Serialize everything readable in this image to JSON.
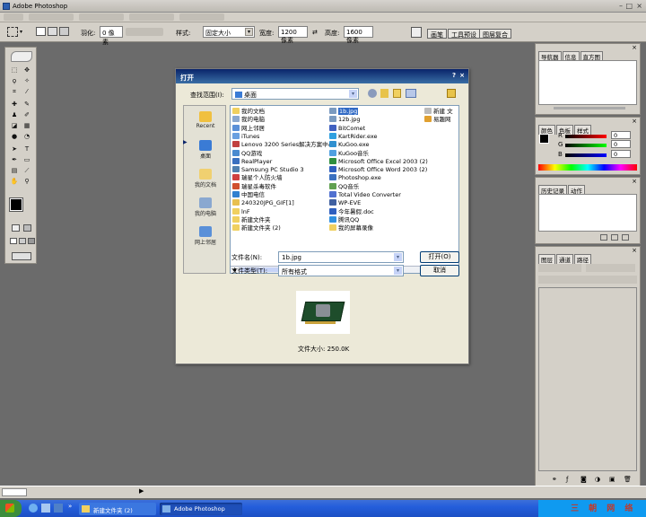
{
  "window": {
    "title": "Adobe Photoshop"
  },
  "options_bar": {
    "feather_label": "羽化:",
    "feather_value": "0 像素",
    "style_label": "样式:",
    "style_value": "固定大小",
    "width_label": "宽度:",
    "width_value": "1200 像素",
    "height_label": "高度:",
    "height_value": "1600 像素",
    "palette_tabs": [
      "画笔",
      "工具预设",
      "图层复合"
    ]
  },
  "panels": {
    "navigator_tabs": [
      "导航器",
      "信息",
      "直方图"
    ],
    "color_tabs": [
      "颜色",
      "色板",
      "样式"
    ],
    "color_values": [
      {
        "channel": "R",
        "value": "0"
      },
      {
        "channel": "G",
        "value": "0"
      },
      {
        "channel": "B",
        "value": "0"
      }
    ],
    "history_tabs": [
      "历史记录",
      "动作"
    ],
    "layers_tabs": [
      "图层",
      "通道",
      "路径"
    ]
  },
  "dialog": {
    "title": "打开",
    "help": "?",
    "close": "×",
    "look_in_label": "查找范围(I):",
    "look_in_value": "桌面",
    "places": [
      "Recent",
      "桌面",
      "我的文档",
      "我的电脑",
      "网上邻居"
    ],
    "files_col1": [
      "我的文档",
      "我的电脑",
      "网上邻居",
      "iTunes",
      "Lenovo 3200 Series解决方案中心",
      "QQ游戏",
      "RealPlayer",
      "Samsung PC Studio 3",
      "瑞星个人防火墙",
      "瑞星杀毒软件",
      "中国电信",
      "240320JPG_GIF[1]",
      "lnF",
      "新建文件夹",
      "新建文件夹 (2)"
    ],
    "files_col2": [
      "1b.jpg",
      "12b.jpg",
      "BitComet",
      "KartRider.exe",
      "KuGoo.exe",
      "KuGoo音乐",
      "Microsoft Office Excel 2003 (2)",
      "Microsoft Office Word 2003 (2)",
      "Photoshop.exe",
      "QQ音乐",
      "Total Video Converter",
      "WP-EVE",
      "今年暑假.doc",
      "腾讯QQ",
      "我的屏幕录像"
    ],
    "files_col3": [
      "新建 文",
      "易趣网"
    ],
    "selected_file": "1b.jpg",
    "filename_label": "文件名(N):",
    "filename_value": "1b.jpg",
    "filetype_label": "文件类型(T):",
    "filetype_value": "所有格式",
    "open_button": "打开(O)",
    "cancel_button": "取消",
    "file_size": "文件大小: 250.0K"
  },
  "taskbar": {
    "tasks": [
      "新建文件夹 (2)",
      "Adobe Photoshop"
    ],
    "watermark": "三 朝 网 络"
  },
  "colors": {
    "dialog_title": "#0a246a",
    "taskbar": "#245edb",
    "selection": "#316ac5",
    "canvas_bg": "#6b6b6b"
  }
}
